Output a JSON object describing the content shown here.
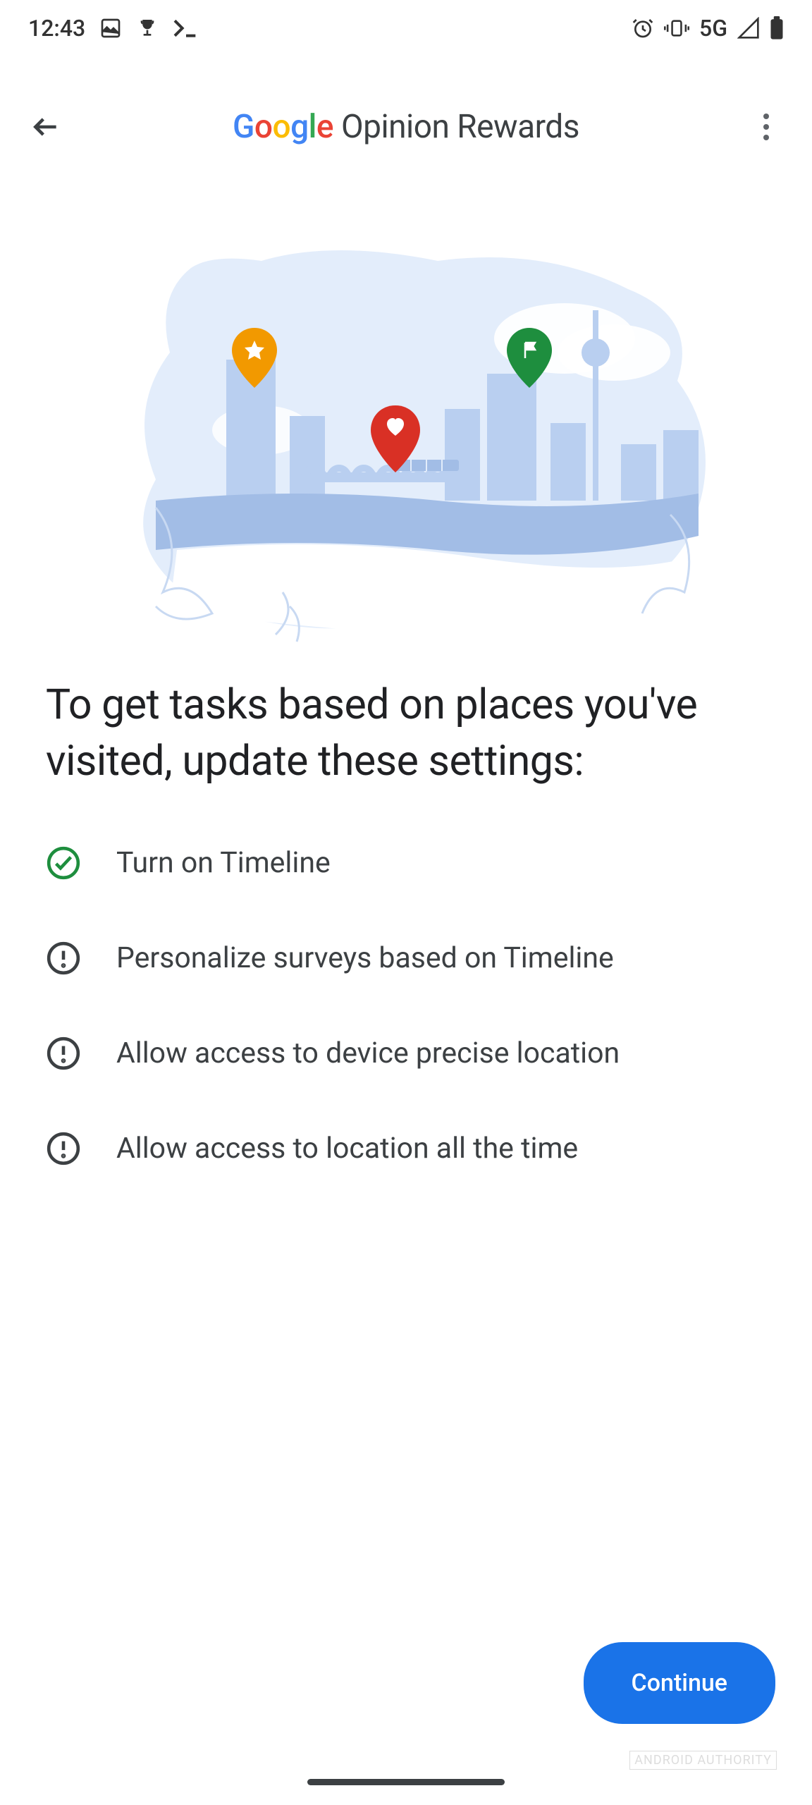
{
  "status": {
    "time": "12:43",
    "network": "5G"
  },
  "appbar": {
    "title_suffix": "Opinion Rewards"
  },
  "heading": "To get tasks based on places you've visited, update these settings:",
  "settings": [
    {
      "label": "Turn on Timeline",
      "status": "done"
    },
    {
      "label": "Personalize surveys based on Timeline",
      "status": "alert"
    },
    {
      "label": "Allow access to device precise location",
      "status": "alert"
    },
    {
      "label": "Allow access to location all the time",
      "status": "alert"
    }
  ],
  "cta": {
    "continue": "Continue"
  },
  "watermark": "ANDROID AUTHORITY"
}
